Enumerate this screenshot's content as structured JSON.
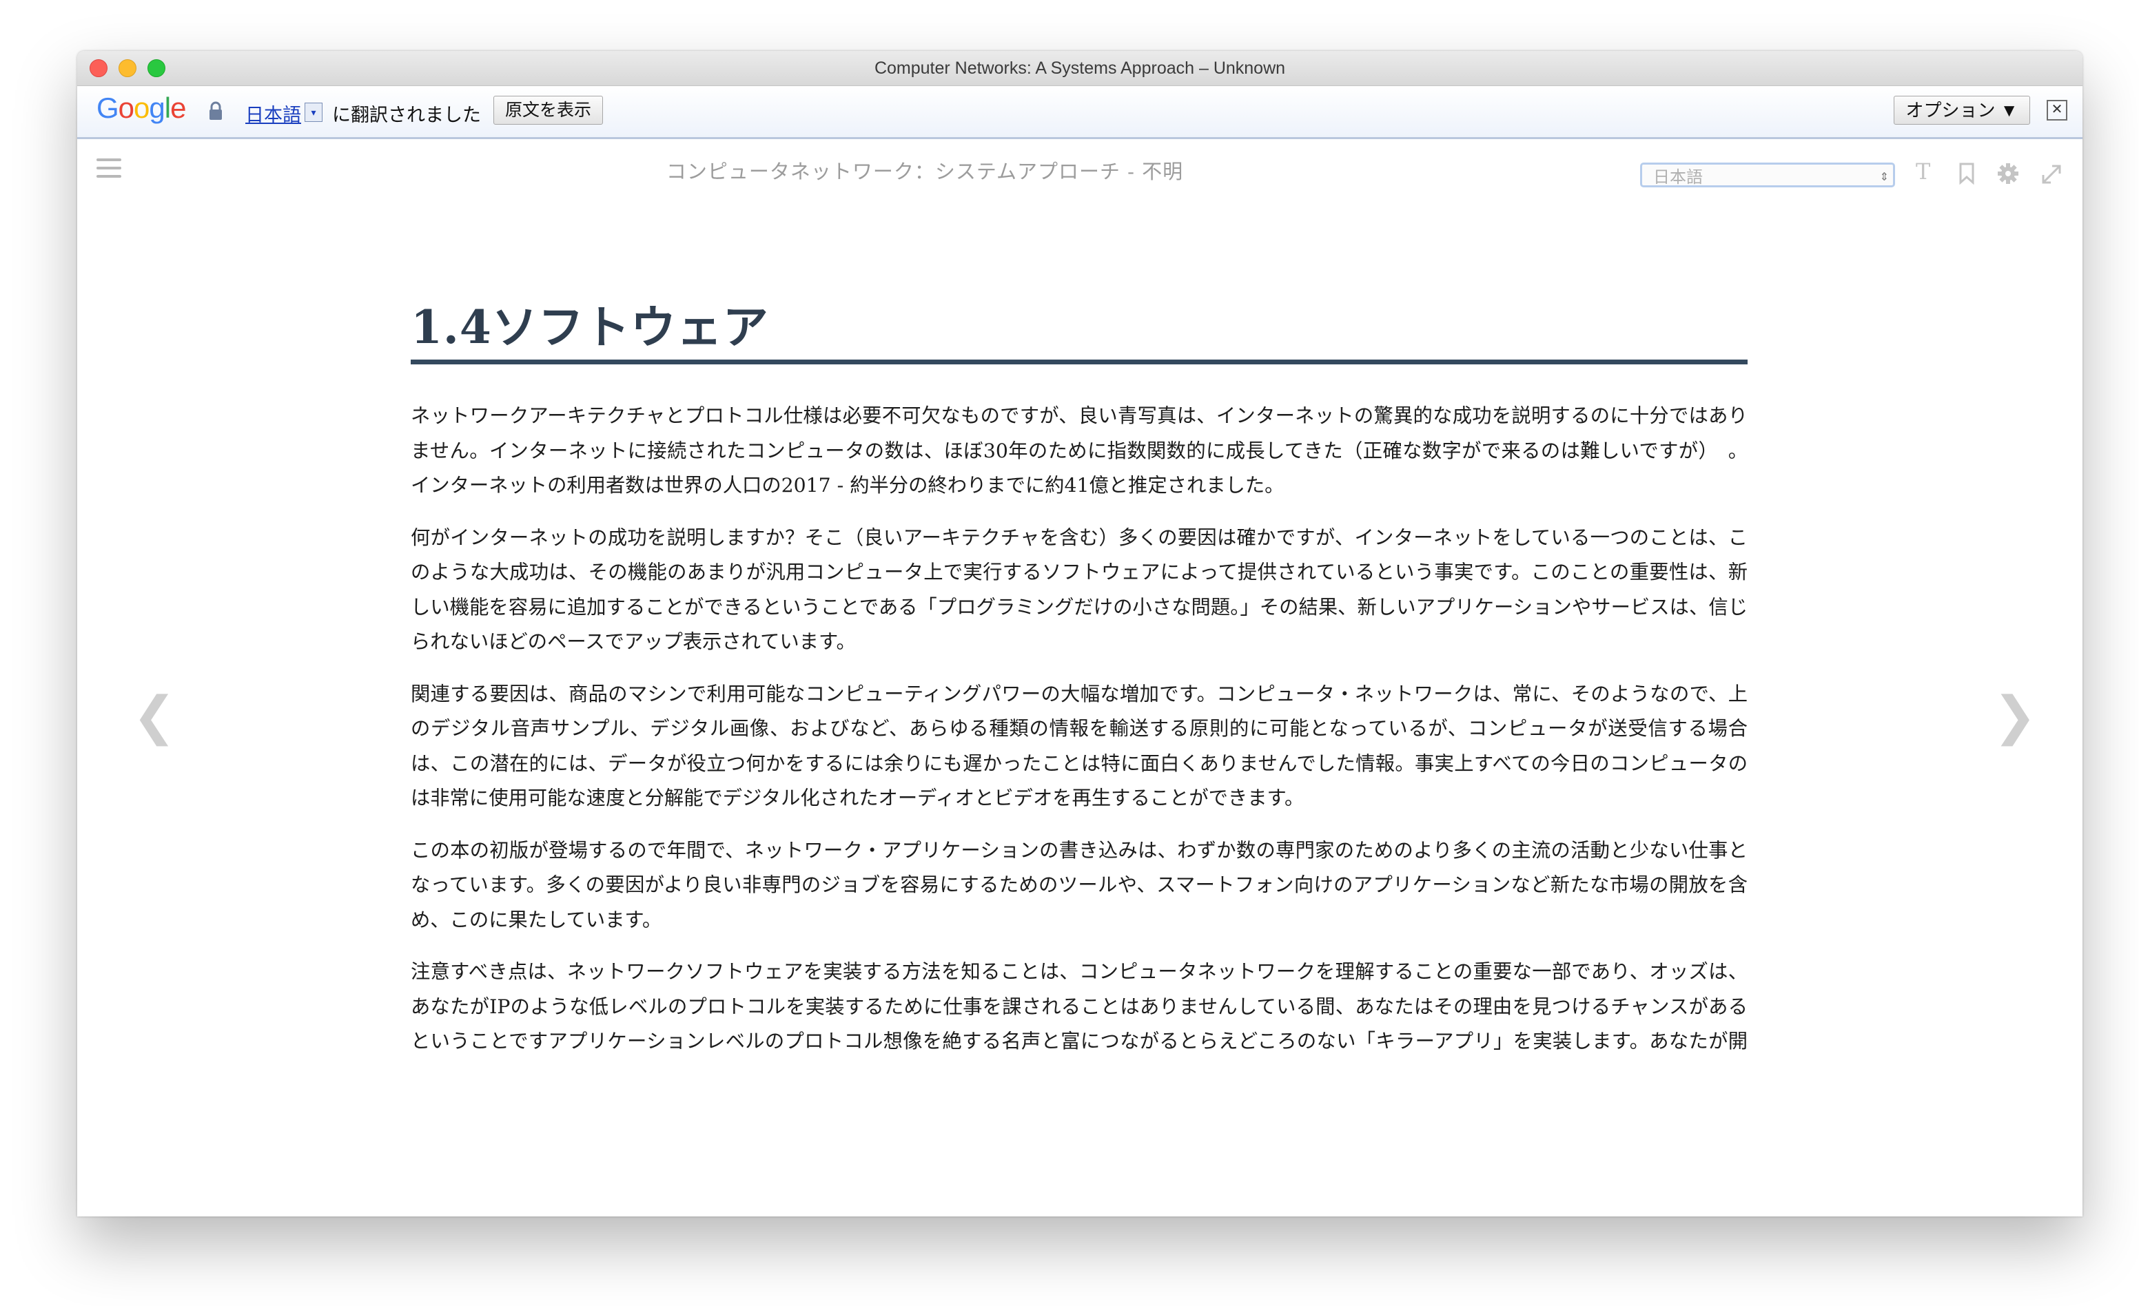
{
  "window": {
    "title": "Computer Networks: A Systems Approach – Unknown"
  },
  "translate_bar": {
    "logo_text": "Google",
    "logo_colors": [
      "#4285f4",
      "#ea4335",
      "#fbbc05",
      "#4285f4",
      "#34a853",
      "#ea4335"
    ],
    "language_link": "日本語",
    "language_dropdown_glyph": "▾",
    "translated_text": "に翻訳されました",
    "show_original_label": "原文を表示",
    "options_label": "オプション ▼",
    "close_glyph": "✕"
  },
  "reader": {
    "book_title": "コンピュータネットワーク：システムアプローチ  -  不明",
    "language_select_value": "日本語",
    "language_select_arrow": "⇕",
    "font_icon_glyph": "T",
    "prev_glyph": "❮",
    "next_glyph": "❯"
  },
  "content": {
    "heading": "1.4ソフトウェア",
    "paragraphs": [
      "ネットワークアーキテクチャとプロトコル仕様は必要不可欠なものですが、良い青写真は、インターネットの驚異的な成功を説明するのに十分ではありません。インターネットに接続されたコンピュータの数は、ほぼ30年のために指数関数的に成長してきた（正確な数字がで来るのは難しいですが）　。インターネットの利用者数は世界の人口の2017 - 約半分の終わりまでに約41億と推定されました。",
      "何がインターネットの成功を説明しますか？そこ（良いアーキテクチャを含む）多くの要因は確かですが、インターネットをしている一つのことは、このような大成功は、その機能のあまりが汎用コンピュータ上で実行するソフトウェアによって提供されているという事実です。このことの重要性は、新しい機能を容易に追加することができるということである「プログラミングだけの小さな問題。」その結果、新しいアプリケーションやサービスは、信じられないほどのペースでアップ表示されています。",
      "関連する要因は、商品のマシンで利用可能なコンピューティングパワーの大幅な増加です。コンピュータ・ネットワークは、常に、そのようなので、上のデジタル音声サンプル、デジタル画像、およびなど、あらゆる種類の情報を輸送する原則的に可能となっているが、コンピュータが送受信する場合は、この潜在的には、データが役立つ何かをするには余りにも遅かったことは特に面白くありませんでした情報。事実上すべての今日のコンピュータのは非常に使用可能な速度と分解能でデジタル化されたオーディオとビデオを再生することができます。",
      "この本の初版が登場するので年間で、ネットワーク・アプリケーションの書き込みは、わずか数の専門家のためのより多くの主流の活動と少ない仕事となっています。多くの要因がより良い非専門のジョブを容易にするためのツールや、スマートフォン向けのアプリケーションなど新たな市場の開放を含め、このに果たしています。",
      "注意すべき点は、ネットワークソフトウェアを実装する方法を知ることは、コンピュータネットワークを理解することの重要な一部であり、オッズは、あなたがIPのような低レベルのプロトコルを実装するために仕事を課されることはありませんしている間、あなたはその理由を見つけるチャンスがあるということですアプリケーションレベルのプロトコル想像を絶する名声と富につながるとらえどころのない「キラーアプリ」を実装します。あなたが開始するには、このセクションでは、インターネットの上のネットワークアプリケーションを実装するための問題を紹介します。"
    ]
  }
}
